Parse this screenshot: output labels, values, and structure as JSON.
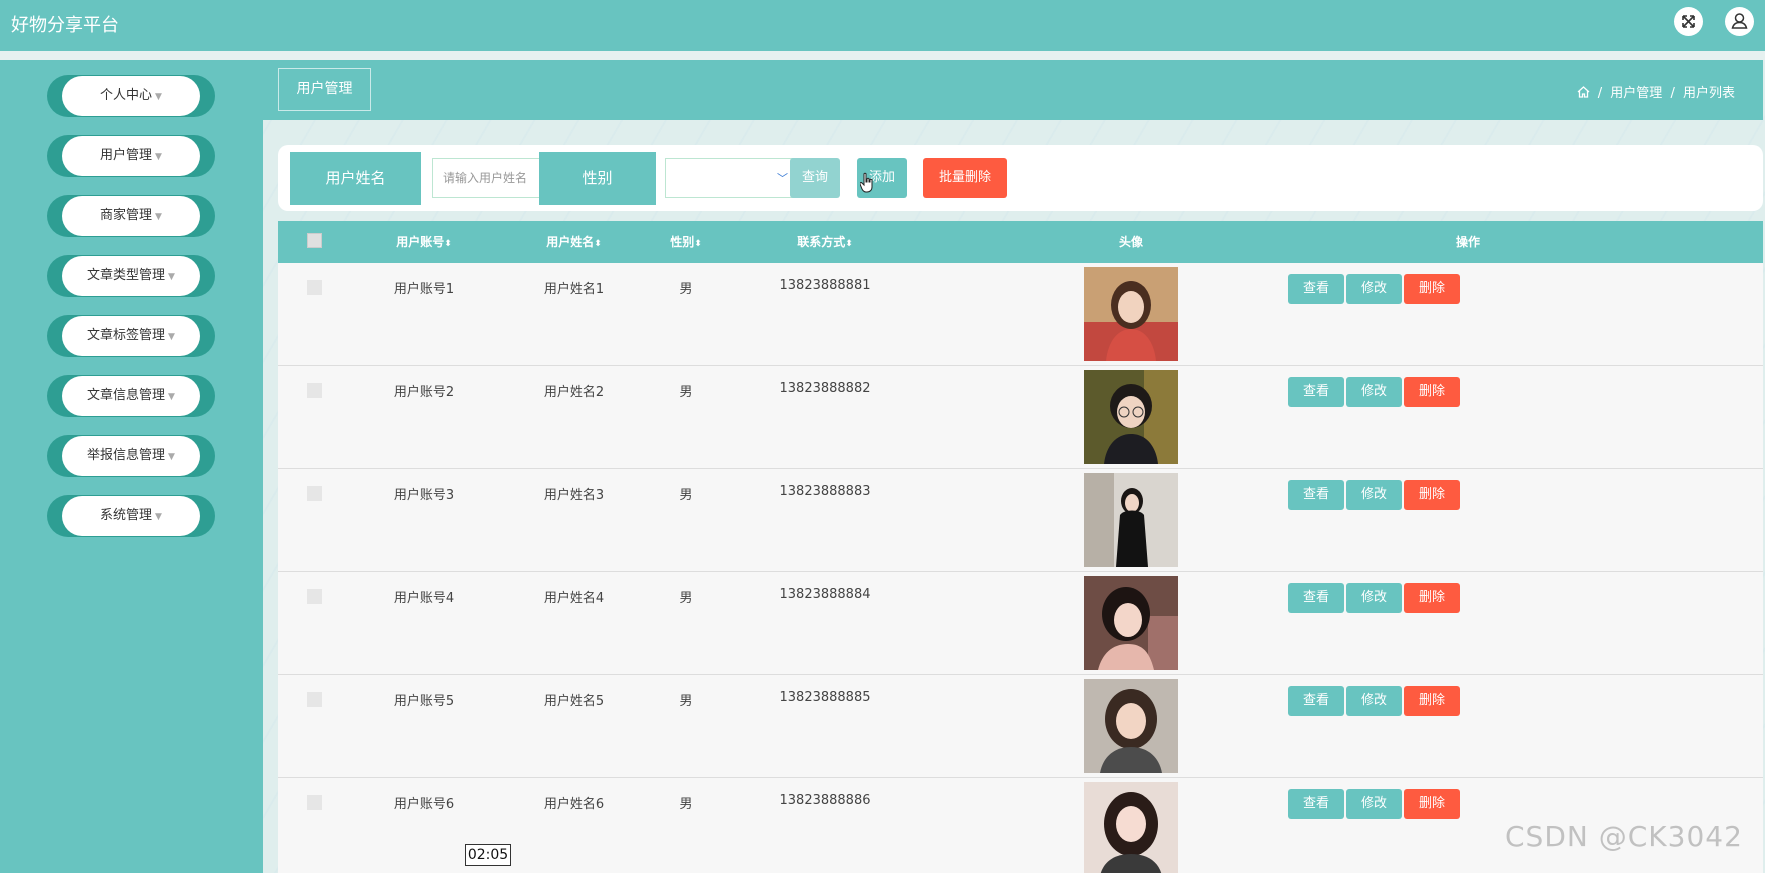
{
  "app": {
    "title": "好物分享平台"
  },
  "header_icons": [
    "fullscreen-icon",
    "user-icon"
  ],
  "colors": {
    "primary": "#68c4c0",
    "danger": "#fe5b40",
    "menu_accent": "#2e9e93"
  },
  "sidebar": {
    "items": [
      {
        "label": "个人中心"
      },
      {
        "label": "用户管理"
      },
      {
        "label": "商家管理"
      },
      {
        "label": "文章类型管理"
      },
      {
        "label": "文章标签管理"
      },
      {
        "label": "文章信息管理"
      },
      {
        "label": "举报信息管理"
      },
      {
        "label": "系统管理"
      }
    ]
  },
  "page": {
    "tab_label": "用户管理",
    "breadcrumb": [
      "用户管理",
      "用户列表"
    ]
  },
  "search": {
    "name_label": "用户姓名",
    "name_placeholder": "请输入用户姓名",
    "gender_label": "性别",
    "gender_value": "",
    "query_button": "查询",
    "add_button": "添加",
    "batch_delete_button": "批量删除"
  },
  "table": {
    "columns": [
      "用户账号",
      "用户姓名",
      "性别",
      "联系方式",
      "头像",
      "操作"
    ],
    "actions": {
      "view": "查看",
      "edit": "修改",
      "delete": "删除"
    },
    "rows": [
      {
        "account": "用户账号1",
        "name": "用户姓名1",
        "gender": "男",
        "phone": "13823888881"
      },
      {
        "account": "用户账号2",
        "name": "用户姓名2",
        "gender": "男",
        "phone": "13823888882"
      },
      {
        "account": "用户账号3",
        "name": "用户姓名3",
        "gender": "男",
        "phone": "13823888883"
      },
      {
        "account": "用户账号4",
        "name": "用户姓名4",
        "gender": "男",
        "phone": "13823888884"
      },
      {
        "account": "用户账号5",
        "name": "用户姓名5",
        "gender": "男",
        "phone": "13823888885"
      },
      {
        "account": "用户账号6",
        "name": "用户姓名6",
        "gender": "男",
        "phone": "13823888886"
      }
    ]
  },
  "overlay": {
    "timestamp": "02:05",
    "watermark": "CSDN @CK3042"
  }
}
